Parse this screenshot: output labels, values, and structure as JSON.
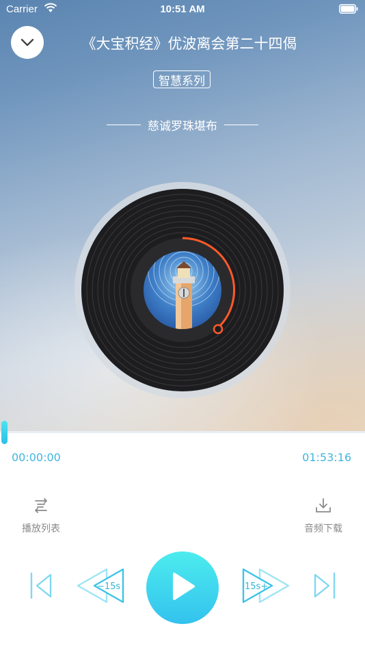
{
  "status_bar": {
    "carrier": "Carrier",
    "time": "10:51 AM"
  },
  "header": {
    "title": "《大宝积经》优波离会第二十四偈",
    "series": "智慧系列",
    "artist": "慈诚罗珠堪布"
  },
  "player": {
    "elapsed": "00:00:00",
    "total": "01:53:16",
    "progress": 0.0,
    "rewind_label": "−15s",
    "forward_label": "15s+"
  },
  "actions": {
    "playlist_label": "播放列表",
    "download_label": "音频下载"
  },
  "icons": {
    "collapse": "chevron-down-icon",
    "playlist": "playlist-icon",
    "download": "download-icon",
    "prev": "skip-previous-icon",
    "rewind": "rewind-icon",
    "play": "play-icon",
    "forward": "fast-forward-icon",
    "next": "skip-next-icon"
  },
  "colors": {
    "accent": "#35c9e6",
    "time_text": "#3fb6e0",
    "label_text": "#8a8a8a"
  }
}
